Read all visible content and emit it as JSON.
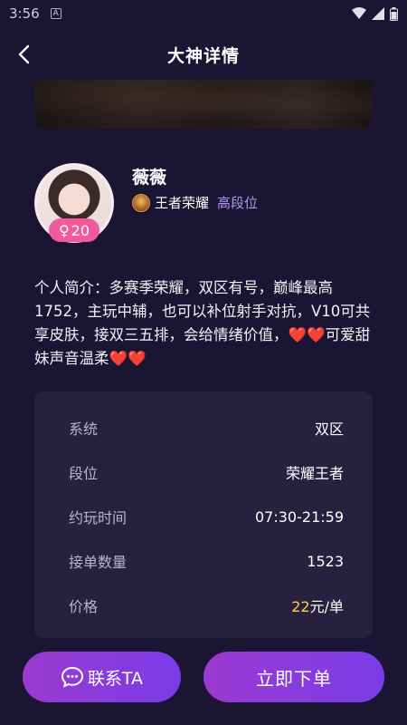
{
  "status_bar": {
    "time": "3:56",
    "notif_icon": "A"
  },
  "header": {
    "title": "大神详情"
  },
  "profile": {
    "name": "薇薇",
    "gender_symbol": "♀",
    "age": "20",
    "game": "王者荣耀",
    "rank_tag": "高段位"
  },
  "bio": "个人简介：多赛季荣耀，双区有号，巅峰最高1752，主玩中辅，也可以补位射手对抗，V10可共享皮肤，接双三五排，会给情绪价值，❤️❤️可爱甜妹声音温柔❤️❤️",
  "info": {
    "system": {
      "label": "系统",
      "value": "双区"
    },
    "rank": {
      "label": "段位",
      "value": "荣耀王者"
    },
    "time": {
      "label": "约玩时间",
      "value": "07:30-21:59"
    },
    "orders": {
      "label": "接单数量",
      "value": "1523"
    },
    "price": {
      "label": "价格",
      "amount": "22",
      "unit": "元/单"
    }
  },
  "buttons": {
    "contact": "联系TA",
    "order": "立即下单"
  },
  "colors": {
    "background": "#1a1533",
    "card": "#27203f",
    "accent_purple": "#7a3ce8",
    "price_yellow": "#ffd23f",
    "badge_pink": "#f25a9e",
    "rank_tag": "#b394f0"
  }
}
